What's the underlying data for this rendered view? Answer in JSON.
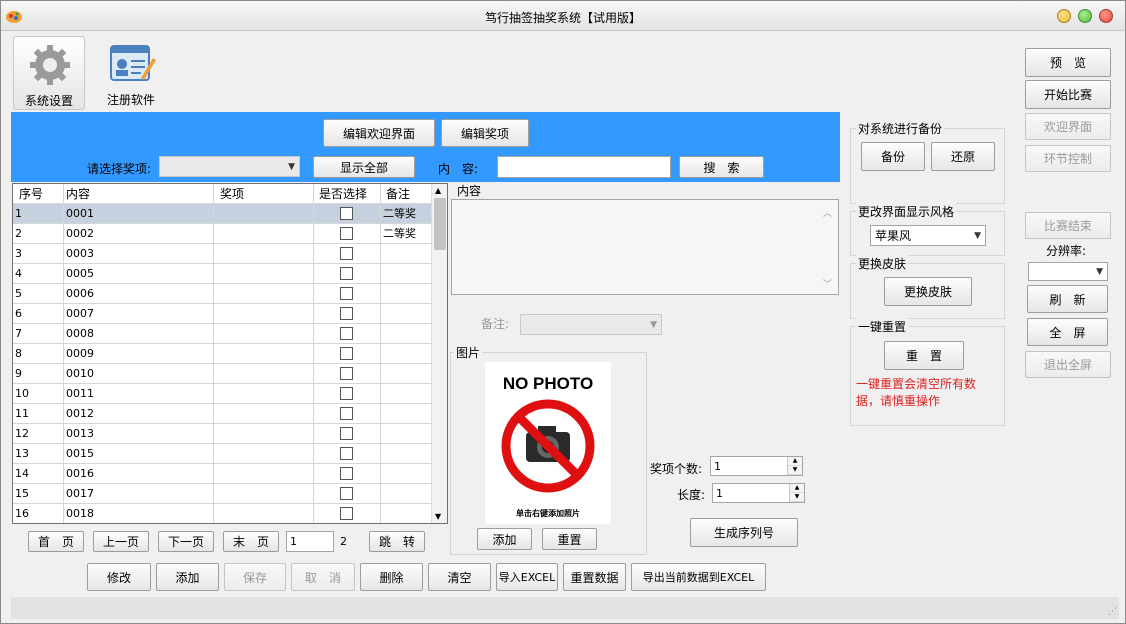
{
  "window": {
    "title": "笃行抽签抽奖系统【试用版】"
  },
  "toolbar": {
    "system_settings": "系统设置",
    "register_software": "注册软件"
  },
  "blue_bar": {
    "edit_welcome": "编辑欢迎界面",
    "edit_prize": "编辑奖项",
    "choose_prize_label": "请选择奖项:",
    "show_all": "显示全部",
    "content_label": "内　容:",
    "content_value": "",
    "search": "搜　索"
  },
  "table": {
    "headers": [
      "序号",
      "内容",
      "奖项",
      "是否选择",
      "备注"
    ],
    "rows": [
      {
        "no": "1",
        "content": "0001",
        "remark": "二等奖"
      },
      {
        "no": "2",
        "content": "0002",
        "remark": "二等奖"
      },
      {
        "no": "3",
        "content": "0003",
        "remark": ""
      },
      {
        "no": "4",
        "content": "0005",
        "remark": ""
      },
      {
        "no": "5",
        "content": "0006",
        "remark": ""
      },
      {
        "no": "6",
        "content": "0007",
        "remark": ""
      },
      {
        "no": "7",
        "content": "0008",
        "remark": ""
      },
      {
        "no": "8",
        "content": "0009",
        "remark": ""
      },
      {
        "no": "9",
        "content": "0010",
        "remark": ""
      },
      {
        "no": "10",
        "content": "0011",
        "remark": ""
      },
      {
        "no": "11",
        "content": "0012",
        "remark": ""
      },
      {
        "no": "12",
        "content": "0013",
        "remark": ""
      },
      {
        "no": "13",
        "content": "0015",
        "remark": ""
      },
      {
        "no": "14",
        "content": "0016",
        "remark": ""
      },
      {
        "no": "15",
        "content": "0017",
        "remark": ""
      },
      {
        "no": "16",
        "content": "0018",
        "remark": ""
      }
    ]
  },
  "pager": {
    "first": "首　页",
    "prev": "上一页",
    "next": "下一页",
    "last": "末　页",
    "page_value": "1",
    "total_pages": "2",
    "jump": "跳　转"
  },
  "detail": {
    "content_label": "内容",
    "remark_label": "备注:",
    "picture_label": "图片",
    "no_photo": "NO PHOTO",
    "photo_hint": "单击右键添加照片",
    "add_photo": "添加",
    "reset_photo": "重置",
    "prize_count_label": "奖项个数:",
    "prize_count_value": "1",
    "length_label": "长度:",
    "length_value": "1",
    "generate_serial": "生成序列号"
  },
  "actions": {
    "modify": "修改",
    "add": "添加",
    "save": "保存",
    "cancel": "取　消",
    "delete": "删除",
    "clear": "清空",
    "import_excel": "导入EXCEL",
    "reset_data": "重置数据",
    "export_excel": "导出当前数据到EXCEL"
  },
  "settings": {
    "backup_group": "对系统进行备份",
    "backup": "备份",
    "restore": "还原",
    "style_group": "更改界面显示风格",
    "style_value": "苹果风",
    "skin_group": "更换皮肤",
    "change_skin": "更换皮肤",
    "reset_group": "一键重置",
    "reset": "重　置",
    "reset_warning": "一键重置会清空所有数据，请慎重操作"
  },
  "right_panel": {
    "preview": "预　览",
    "start_game": "开始比赛",
    "welcome": "欢迎界面",
    "stage_control": "环节控制",
    "end_game": "比赛结束",
    "resolution_label": "分辨率:",
    "refresh": "刷　新",
    "fullscreen": "全　屏",
    "exit_fullscreen": "退出全屏"
  },
  "colors": {
    "accent": "#3399ff",
    "warning": "#e02020",
    "close": "#e8423a",
    "minimize": "#f1b72f",
    "maximize": "#4fbe3b"
  }
}
